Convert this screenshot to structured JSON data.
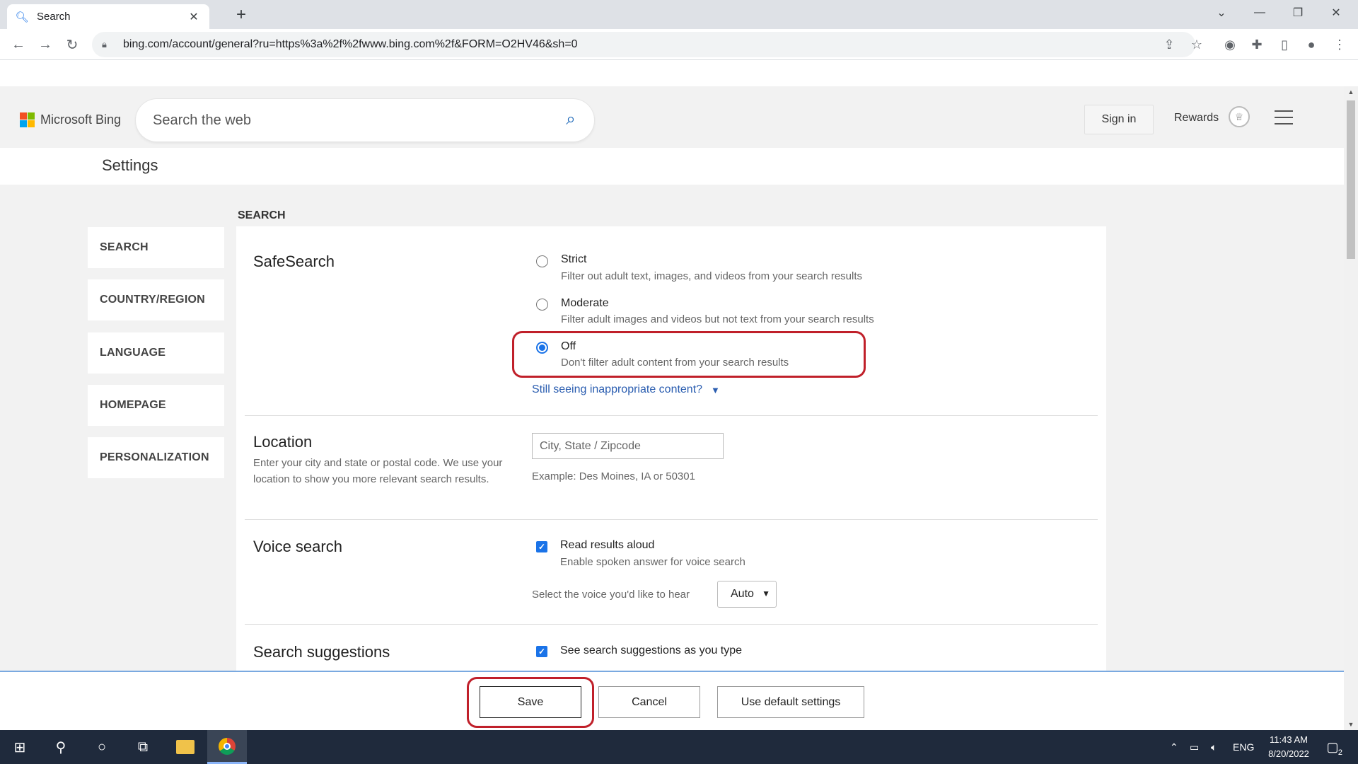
{
  "browser": {
    "tab_title": "Search",
    "url": "bing.com/account/general?ru=https%3a%2f%2fwww.bing.com%2f&FORM=O2HV46&sh=0",
    "new_tab_symbol": "+",
    "tab_close_symbol": "✕"
  },
  "header": {
    "brand": "Microsoft Bing",
    "search_placeholder": "Search the web",
    "sign_in": "Sign in",
    "rewards": "Rewards"
  },
  "settings_title": "Settings",
  "sidebar": {
    "items": [
      {
        "label": "SEARCH"
      },
      {
        "label": "COUNTRY/REGION"
      },
      {
        "label": "LANGUAGE"
      },
      {
        "label": "HOMEPAGE"
      },
      {
        "label": "PERSONALIZATION"
      }
    ]
  },
  "section_label": "SEARCH",
  "safesearch": {
    "title": "SafeSearch",
    "options": [
      {
        "label": "Strict",
        "desc": "Filter out adult text, images, and videos from your search results",
        "checked": false
      },
      {
        "label": "Moderate",
        "desc": "Filter adult images and videos but not text from your search results",
        "checked": false
      },
      {
        "label": "Off",
        "desc": "Don't filter adult content from your search results",
        "checked": true
      }
    ],
    "still_seeing": "Still seeing inappropriate content?"
  },
  "location": {
    "title": "Location",
    "desc": "Enter your city and state or postal code. We use your location to show you more relevant search results.",
    "placeholder": "City, State / Zipcode",
    "example": "Example: Des Moines, IA or 50301"
  },
  "voice_search": {
    "title": "Voice search",
    "checkbox_label": "Read results aloud",
    "checkbox_desc": "Enable spoken answer for voice search",
    "checked": true,
    "select_label": "Select the voice you'd like to hear",
    "select_value": "Auto"
  },
  "search_suggestions": {
    "title": "Search suggestions",
    "checkbox_label": "See search suggestions as you type",
    "checked": true
  },
  "actions": {
    "save": "Save",
    "cancel": "Cancel",
    "default": "Use default settings"
  },
  "taskbar": {
    "language": "ENG",
    "time": "11:43 AM",
    "date": "8/20/2022",
    "notifications": "2"
  },
  "colors": {
    "accent": "#1a73e8",
    "highlight": "#c0202a",
    "link": "#2a5db0"
  }
}
